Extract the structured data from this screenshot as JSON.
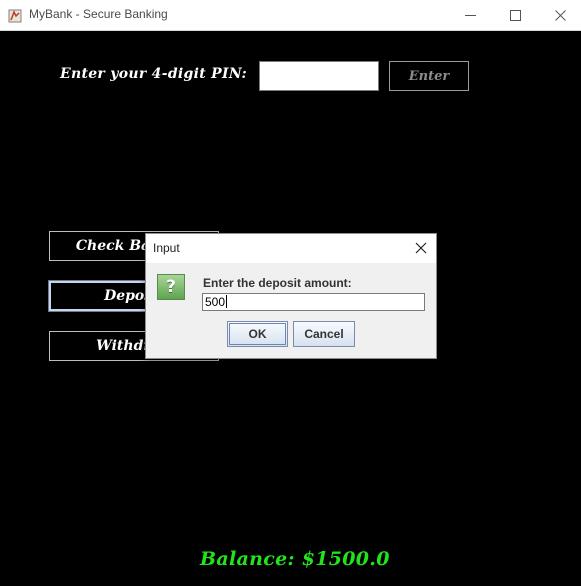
{
  "window": {
    "title": "MyBank - Secure Banking",
    "icons": [
      "app-icon",
      "minimize-icon",
      "maximize-icon",
      "close-icon"
    ]
  },
  "pin": {
    "label": "Enter your 4-digit PIN:",
    "value": "",
    "enter_label": "Enter"
  },
  "menu": {
    "check_balance_label": "Check Balance",
    "deposit_label": "Deposit",
    "withdraw_label": "Withdraw"
  },
  "balance": {
    "text": "Balance: $1500.0"
  },
  "dialog": {
    "title": "Input",
    "icon": "question-icon",
    "icon_glyph": "?",
    "prompt": "Enter the deposit amount:",
    "value": "500",
    "ok_label": "OK",
    "cancel_label": "Cancel"
  },
  "colors": {
    "background": "#000000",
    "balance_text": "#22e41c",
    "button_border": "#bdbdbd"
  }
}
